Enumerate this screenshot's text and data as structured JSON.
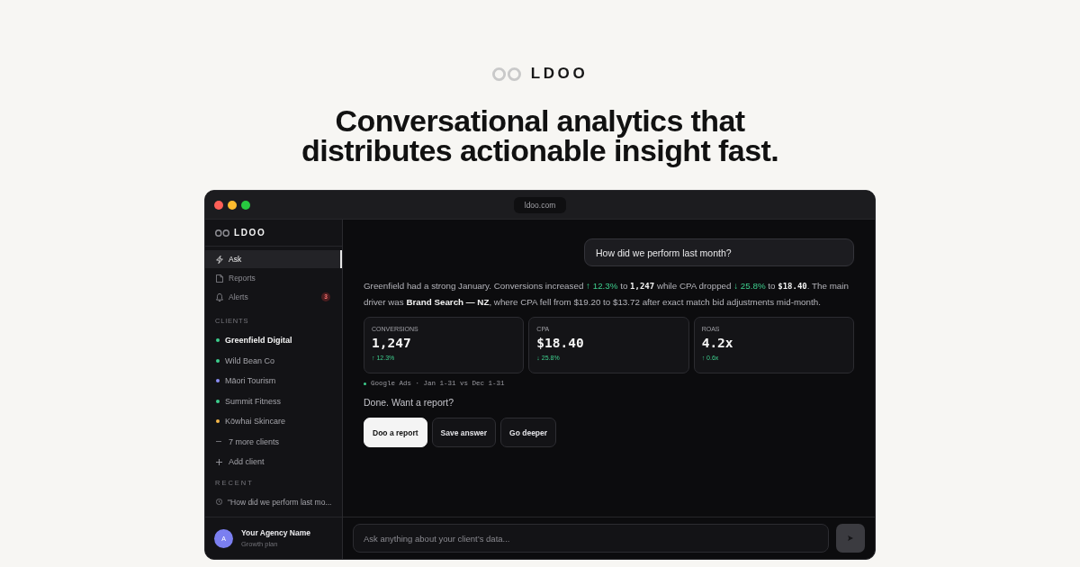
{
  "brand": {
    "wordmark": "LDOO"
  },
  "headline": "Conversational analytics that distributes actionable insight fast.",
  "window": {
    "url": "ldoo.com"
  },
  "sidebar": {
    "wordmark": "LDOO",
    "nav": [
      {
        "label": "Ask",
        "selected": true
      },
      {
        "label": "Reports",
        "selected": false
      },
      {
        "label": "Alerts",
        "selected": false,
        "badge": "3"
      }
    ],
    "clients_heading": "CLIENTS",
    "clients": [
      {
        "name": "Greenfield Digital",
        "color": "#3ecf8e",
        "selected": true
      },
      {
        "name": "Wild Bean Co",
        "color": "#3ecf8e",
        "selected": false
      },
      {
        "name": "Māori Tourism",
        "color": "#8b8ff5",
        "selected": false
      },
      {
        "name": "Summit Fitness",
        "color": "#3ecf8e",
        "selected": false
      },
      {
        "name": "Kōwhai Skincare",
        "color": "#f5b84a",
        "selected": false
      }
    ],
    "more_clients": "7 more clients",
    "add_client": "Add client",
    "recent_heading": "RECENT",
    "recent": [
      "\"How did we perform last mo..."
    ],
    "account": {
      "initial": "A",
      "name": "Your Agency Name",
      "plan": "Growth plan"
    }
  },
  "chat": {
    "question": "How did we perform last month?",
    "answer": [
      {
        "kind": "text",
        "text": "Greenfield had a strong January. Conversions increased "
      },
      {
        "kind": "positive",
        "text": "↑ 12.3%"
      },
      {
        "kind": "text",
        "text": " to "
      },
      {
        "kind": "mono",
        "text": "1,247"
      },
      {
        "kind": "text",
        "text": " while CPA dropped "
      },
      {
        "kind": "positive",
        "text": "↓ 25.8%"
      },
      {
        "kind": "text",
        "text": " to "
      },
      {
        "kind": "mono",
        "text": "$18.40"
      },
      {
        "kind": "text",
        "text": ". The main driver was "
      },
      {
        "kind": "bold",
        "text": "Brand Search — NZ"
      },
      {
        "kind": "text",
        "text": ", where CPA fell from $19.20 to $13.72 after exact match bid adjustments mid-month."
      }
    ],
    "metrics": [
      {
        "label": "CONVERSIONS",
        "value": "1,247",
        "change": "↑ 12.3%"
      },
      {
        "label": "CPA",
        "value": "$18.40",
        "change": "↓ 25.8%"
      },
      {
        "label": "ROAS",
        "value": "4.2x",
        "change": "↑ 0.6x"
      }
    ],
    "source": "Google Ads · Jan 1-31 vs Dec 1-31",
    "followup": "Done. Want a report?",
    "actions": [
      {
        "label": "Doo a report",
        "primary": true
      },
      {
        "label": "Save answer",
        "primary": false
      },
      {
        "label": "Go deeper",
        "primary": false
      }
    ]
  },
  "composer": {
    "placeholder": "Ask anything about your client’s data..."
  }
}
